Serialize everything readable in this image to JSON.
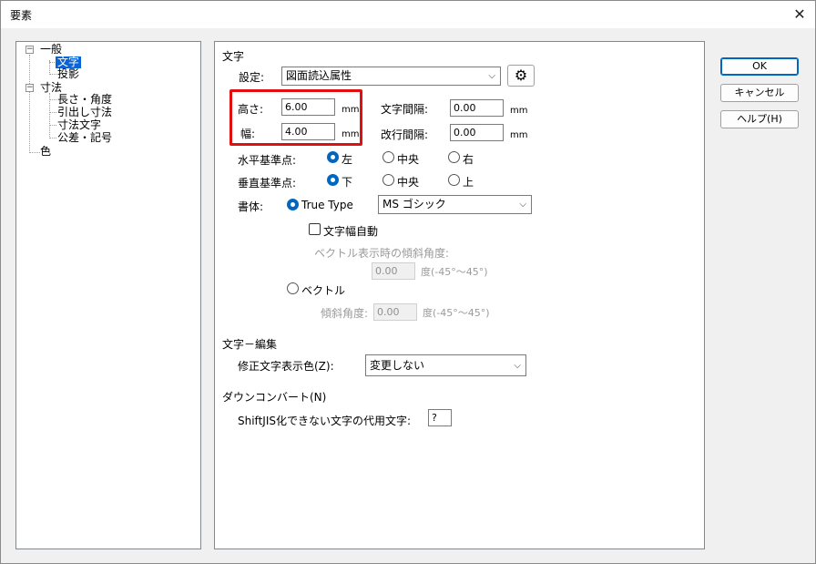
{
  "window": {
    "title": "要素",
    "close_glyph": "✕"
  },
  "tree": {
    "items": [
      {
        "label": "一般"
      },
      {
        "label": "文字"
      },
      {
        "label": "投影"
      },
      {
        "label": "寸法"
      },
      {
        "label": "長さ・角度"
      },
      {
        "label": "引出し寸法"
      },
      {
        "label": "寸法文字"
      },
      {
        "label": "公差・記号"
      },
      {
        "label": "色"
      }
    ],
    "expander_minus": "−"
  },
  "main": {
    "moji_section": "文字",
    "settings_label": "設定:",
    "settings_value": "図面読込属性",
    "height_label": "高さ:",
    "height_value": "6.00",
    "width_label": "幅:",
    "width_value": "4.00",
    "unit_mm": "mm",
    "char_spacing_label": "文字間隔:",
    "char_spacing_value": "0.00",
    "line_spacing_label": "改行間隔:",
    "line_spacing_value": "0.00",
    "h_align_label": "水平基準点:",
    "h_align_options": [
      "左",
      "中央",
      "右"
    ],
    "v_align_label": "垂直基準点:",
    "v_align_options": [
      "下",
      "中央",
      "上"
    ],
    "font_label": "書体:",
    "truetype_label": "True Type",
    "font_value": "MS ゴシック",
    "auto_width_label": "文字幅自動",
    "vector_tilt_label": "ベクトル表示時の傾斜角度:",
    "vector_tilt_value": "0.00",
    "tilt_range": "度(-45°〜45°)",
    "vector_label": "ベクトル",
    "tilt_label": "傾斜角度:",
    "tilt_value": "0.00",
    "edit_section": "文字－編集",
    "edit_color_label": "修正文字表示色(Z):",
    "edit_color_value": "変更しない",
    "downconvert_section": "ダウンコンバート(N)",
    "sjis_label": "ShiftJIS化できない文字の代用文字:",
    "sjis_value": "?"
  },
  "buttons": {
    "ok": "OK",
    "cancel": "キャンセル",
    "help": "ヘルプ(H)"
  },
  "icons": {
    "gear": "gear-icon",
    "gear_glyph": "⚙",
    "dropdown_glyph": "⌵"
  },
  "colors": {
    "highlight": "#e01010",
    "selection": "#0a64d6",
    "accent": "#0067c0"
  }
}
